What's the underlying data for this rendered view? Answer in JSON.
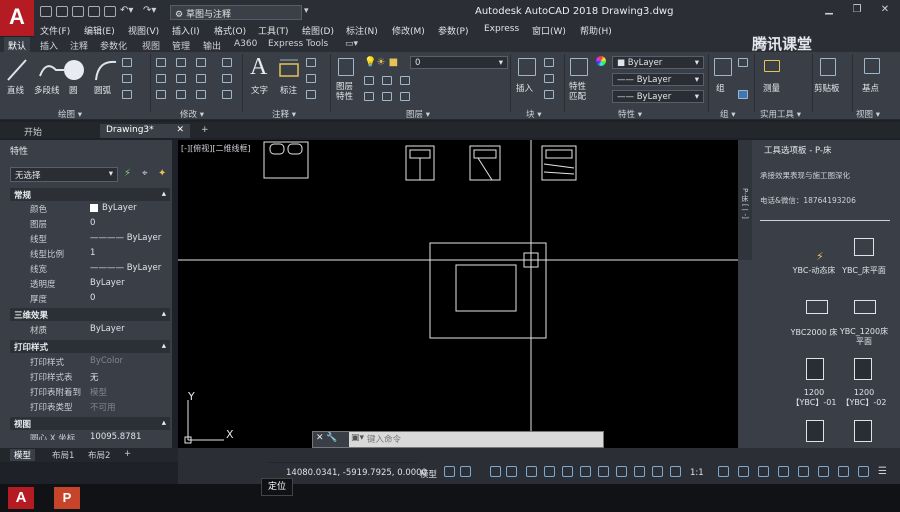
{
  "titlebar": {
    "app_logo": "A",
    "workspace": "草图与注释",
    "title": "Autodesk AutoCAD 2018   Drawing3.dwg"
  },
  "menubar": [
    "文件(F)",
    "编辑(E)",
    "视图(V)",
    "插入(I)",
    "格式(O)",
    "工具(T)",
    "绘图(D)",
    "标注(N)",
    "修改(M)",
    "参数(P)",
    "Express",
    "窗口(W)",
    "帮助(H)"
  ],
  "ribbon_tabs": [
    "默认",
    "插入",
    "注释",
    "参数化",
    "视图",
    "管理",
    "输出",
    "A360",
    "Express Tools"
  ],
  "watermark": "腾讯课堂",
  "ribbon": {
    "draw_tools": [
      "直线",
      "多段线",
      "圆",
      "圆弧"
    ],
    "text": "文字",
    "dimension": "标注",
    "layer_props": "图层\n特性",
    "insert": "插入",
    "match_props": "特性\n匹配",
    "group": "组",
    "measure": "测量",
    "paste": "剪贴板",
    "base": "基点",
    "layer_value": "0",
    "bylayer": "ByLayer",
    "panels": [
      "绘图 ▾",
      "修改 ▾",
      "注释 ▾",
      "图层 ▾",
      "块 ▾",
      "特性 ▾",
      "组 ▾",
      "实用工具 ▾",
      "视图 ▾"
    ]
  },
  "doc_tabs": {
    "start": "开始",
    "drawing": "Drawing3*",
    "plus": "+"
  },
  "properties": {
    "title": "特性",
    "selection": "无选择",
    "sections": {
      "general": "常规",
      "threeD": "三维效果",
      "print": "打印样式",
      "view": "视图"
    },
    "general": [
      {
        "k": "颜色",
        "v": "ByLayer"
      },
      {
        "k": "图层",
        "v": "0"
      },
      {
        "k": "线型",
        "v": "ByLayer"
      },
      {
        "k": "线型比例",
        "v": "1"
      },
      {
        "k": "线宽",
        "v": "ByLayer"
      },
      {
        "k": "透明度",
        "v": "ByLayer"
      },
      {
        "k": "厚度",
        "v": "0"
      }
    ],
    "threeD": [
      {
        "k": "材质",
        "v": "ByLayer"
      }
    ],
    "print": [
      {
        "k": "打印样式",
        "v": "ByColor"
      },
      {
        "k": "打印样式表",
        "v": "无"
      },
      {
        "k": "打印表附着到",
        "v": "模型"
      },
      {
        "k": "打印表类型",
        "v": "不可用"
      }
    ],
    "view_first": {
      "k": "圆心 X 坐标",
      "v": "10095.8781"
    }
  },
  "canvas": {
    "viewport_label": "[-][俯视][二维线框]",
    "y_axis": "Y",
    "x_axis": "X"
  },
  "command": {
    "placeholder": "键入命令"
  },
  "tool_palette": {
    "title": "工具选项板 - P-床",
    "line1": "承接效果表现与施工图深化",
    "line2": "电话&微信：18764193206",
    "side_tab": "P-床 [一-]",
    "items": [
      "YBC-动态床",
      "YBC_床平面",
      "YBC2000 床",
      "YBC_1200床\n平面",
      "1200\n【YBC】-01",
      "1200\n【YBC】-02"
    ]
  },
  "layout_tabs": [
    "模型",
    "布局1",
    "布局2",
    "+"
  ],
  "status": {
    "coords": "14080.0341, -5919.7925, 0.0000",
    "model": "模型",
    "scale": "1:1"
  },
  "tooltip": "定位",
  "colors": {
    "accent": "#b51b22",
    "ribbon_bg": "#3a3f47",
    "canvas_bg": "#000000",
    "panel_dark": "#2b2f35"
  }
}
